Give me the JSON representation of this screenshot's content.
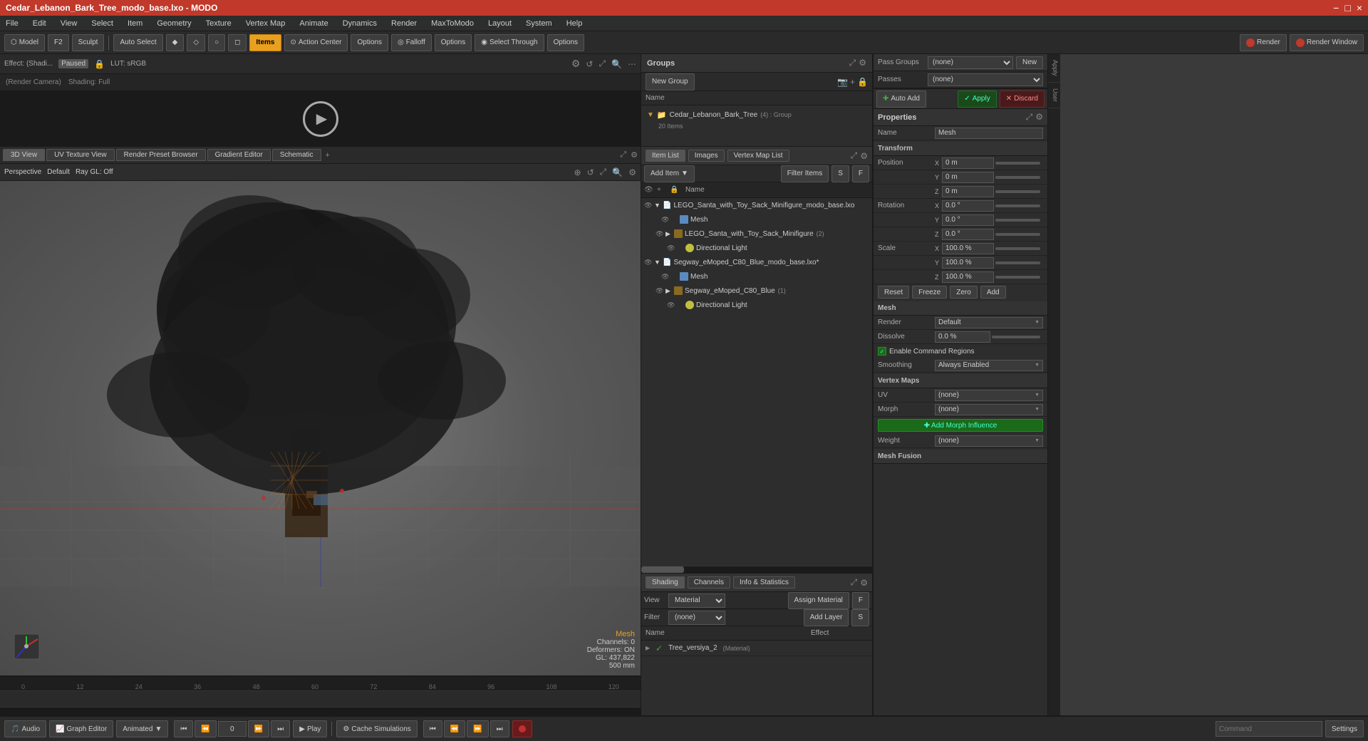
{
  "titlebar": {
    "title": "Cedar_Lebanon_Bark_Tree_modo_base.lxo - MODO",
    "controls": [
      "−",
      "□",
      "×"
    ]
  },
  "menubar": {
    "items": [
      "File",
      "Edit",
      "View",
      "Select",
      "Item",
      "Geometry",
      "Texture",
      "Vertex Map",
      "Animate",
      "Dynamics",
      "Render",
      "MaxToModo",
      "Layout",
      "System",
      "Help"
    ]
  },
  "toolbar": {
    "model_label": "Model",
    "sculpt_label": "Sculpt",
    "auto_select_label": "Auto Select",
    "items_label": "Items",
    "action_center_label": "Action Center",
    "options_label1": "Options",
    "falloff_label": "Falloff",
    "options_label2": "Options",
    "select_through_label": "Select Through",
    "options_label3": "Options",
    "render_label": "Render",
    "render_window_label": "Render Window"
  },
  "preview": {
    "effect_label": "Effect: (Shadi...",
    "paused_label": "Paused",
    "lut_label": "LUT: sRGB",
    "camera_label": "(Render Camera)",
    "shading_label": "Shading: Full"
  },
  "groups": {
    "title": "Groups",
    "new_group_label": "New Group",
    "name_header": "Name",
    "group_name": "Cedar_Lebanon_Bark_Tree",
    "group_suffix": "(4) : Group",
    "group_count": "20 Items",
    "expand_icon": "▶"
  },
  "viewport_tabs": [
    {
      "label": "3D View",
      "active": true
    },
    {
      "label": "UV Texture View",
      "active": false
    },
    {
      "label": "Render Preset Browser",
      "active": false
    },
    {
      "label": "Gradient Editor",
      "active": false
    },
    {
      "label": "Schematic",
      "active": false
    }
  ],
  "viewport": {
    "mode_label": "Perspective",
    "default_label": "Default",
    "ray_gl_label": "Ray GL: Off",
    "stats": {
      "mesh_label": "Mesh",
      "channels": "Channels: 0",
      "deformers": "Deformers: ON",
      "gl": "GL: 437,822",
      "size": "500 mm"
    }
  },
  "item_list": {
    "tabs": [
      {
        "label": "Item List",
        "active": true
      },
      {
        "label": "Images",
        "active": false
      },
      {
        "label": "Vertex Map List",
        "active": false
      }
    ],
    "add_item_label": "Add Item",
    "filter_items_label": "Filter Items",
    "s_label": "S",
    "f_label": "F",
    "items": [
      {
        "level": 0,
        "expanded": true,
        "label": "LEGO_Santa_with_Toy_Sack_Minifigure_modo_base.lxo",
        "type": "file",
        "icon": "file"
      },
      {
        "level": 1,
        "expanded": false,
        "label": "Mesh",
        "type": "mesh",
        "icon": "mesh"
      },
      {
        "level": 1,
        "expanded": true,
        "label": "LEGO_Santa_with_Toy_Sack_Minifigure",
        "type": "group",
        "suffix": "(2)",
        "icon": "group"
      },
      {
        "level": 2,
        "expanded": false,
        "label": "Directional Light",
        "type": "light",
        "icon": "light"
      },
      {
        "level": 0,
        "expanded": true,
        "label": "Segway_eMoped_C80_Blue_modo_base.lxo*",
        "type": "file",
        "icon": "file"
      },
      {
        "level": 1,
        "expanded": false,
        "label": "Mesh",
        "type": "mesh",
        "icon": "mesh"
      },
      {
        "level": 1,
        "expanded": true,
        "label": "Segway_eMoped_C80_Blue",
        "type": "group",
        "suffix": "(1)",
        "icon": "group"
      },
      {
        "level": 2,
        "expanded": false,
        "label": "Directional Light",
        "type": "light",
        "icon": "light"
      }
    ]
  },
  "shading": {
    "tabs": [
      {
        "label": "Shading",
        "active": true
      },
      {
        "label": "Channels",
        "active": false
      },
      {
        "label": "Info & Statistics",
        "active": false
      }
    ],
    "view_label": "View",
    "view_value": "Material",
    "filter_label": "Filter",
    "filter_value": "(none)",
    "assign_material_label": "Assign Material",
    "add_layer_label": "Add Layer",
    "f_label": "F",
    "s_label": "S",
    "col_name": "Name",
    "col_effect": "Effect",
    "materials": [
      {
        "name": "Tree_versiya_2",
        "tag": "(Material)",
        "visible": true
      }
    ]
  },
  "properties": {
    "title": "Properties",
    "name_label": "Name",
    "name_value": "Mesh",
    "sections": {
      "transform": "Transform",
      "mesh": "Mesh",
      "vertex_maps": "Vertex Maps",
      "mesh_fusion": "Mesh Fusion"
    },
    "position": {
      "label": "Position",
      "x": "0 m",
      "y": "0 m",
      "z": "0 m"
    },
    "rotation": {
      "label": "Rotation",
      "x": "0.0 °",
      "y": "0.0 °",
      "z": "0.0 °"
    },
    "scale": {
      "label": "Scale",
      "x": "100.0 %",
      "y": "100.0 %",
      "z": "100.0 %"
    },
    "reset_label": "Reset",
    "freeze_label": "Freeze",
    "zero_label": "Zero",
    "add_label": "Add",
    "render_label": "Render",
    "render_value": "Default",
    "dissolve_label": "Dissolve",
    "dissolve_value": "0.0 %",
    "enable_command_label": "Enable Command Regions",
    "smoothing_label": "Smoothing",
    "smoothing_value": "Always Enabled",
    "uv_label": "UV",
    "uv_value": "(none)",
    "morph_label": "Morph",
    "morph_value": "(none)",
    "add_morph_label": "Add Morph Influence",
    "weight_label": "Weight",
    "weight_value": "(none)"
  },
  "pass_groups": {
    "pass_groups_label": "Pass Groups",
    "passes_label": "Passes",
    "none_option": "(none)",
    "new_label": "New"
  },
  "auto_add": {
    "label": "Auto Add",
    "apply_label": "Apply",
    "discard_label": "Discard"
  },
  "bottom_bar": {
    "audio_label": "Audio",
    "graph_editor_label": "Graph Editor",
    "animated_label": "Animated",
    "cache_simulations_label": "Cache Simulations",
    "play_label": "Play",
    "settings_label": "Settings",
    "frame_value": "0"
  },
  "timeline": {
    "marks": [
      "0",
      "12",
      "24",
      "36",
      "48",
      "60",
      "72",
      "84",
      "96",
      "108",
      "120"
    ],
    "end_mark": "120"
  }
}
